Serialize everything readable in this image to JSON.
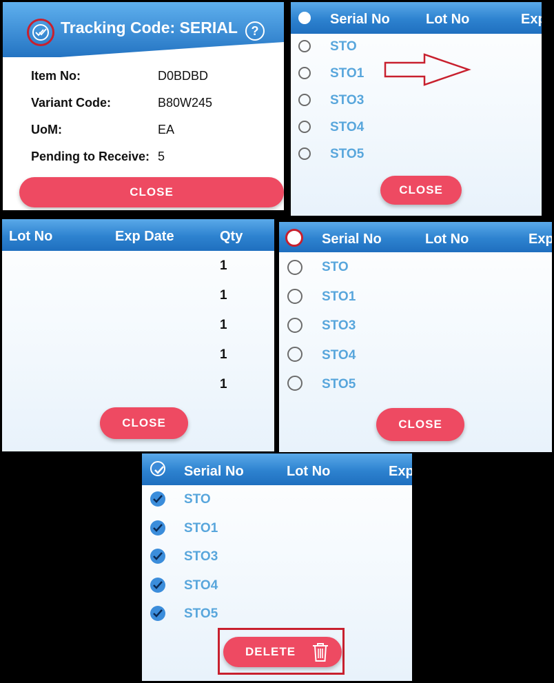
{
  "panel1": {
    "title": "Tracking Code: SERIAL",
    "fields": [
      {
        "label": "Item No:",
        "value": "D0BDBD"
      },
      {
        "label": "Variant Code:",
        "value": "B80W245"
      },
      {
        "label": "UoM:",
        "value": "EA"
      },
      {
        "label": "Pending to Receive:",
        "value": "5"
      }
    ],
    "close_label": "CLOSE"
  },
  "panel2": {
    "columns": [
      "Serial No",
      "Lot No",
      "Exp"
    ],
    "serials": [
      "STO",
      "STO1",
      "STO3",
      "STO4",
      "STO5"
    ],
    "close_label": "CLOSE"
  },
  "panel3": {
    "columns": [
      "Lot No",
      "Exp Date",
      "Qty"
    ],
    "qty": [
      "1",
      "1",
      "1",
      "1",
      "1"
    ],
    "close_label": "CLOSE"
  },
  "panel4": {
    "columns": [
      "Serial No",
      "Lot No",
      "Exp"
    ],
    "serials": [
      "STO",
      "STO1",
      "STO3",
      "STO4",
      "STO5"
    ],
    "close_label": "CLOSE"
  },
  "panel5": {
    "columns": [
      "Serial No",
      "Lot No",
      "Exp"
    ],
    "serials": [
      "STO",
      "STO1",
      "STO3",
      "STO4",
      "STO5"
    ],
    "delete_label": "DELETE"
  },
  "colors": {
    "accent_red": "#ee4a62",
    "header_blue": "#2d82cf",
    "serial_blue": "#58a6dc",
    "highlight_red": "#c8202e"
  },
  "icons": [
    "double-check-icon",
    "help-icon",
    "arrow-right-icon",
    "check-icon",
    "trash-icon"
  ]
}
